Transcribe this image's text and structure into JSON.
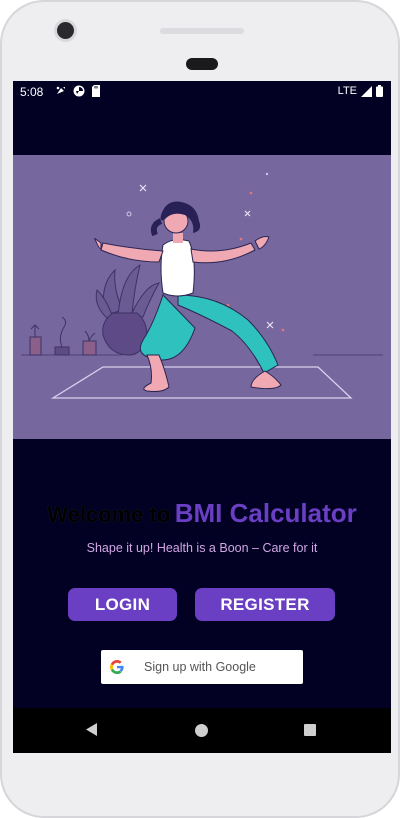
{
  "status_bar": {
    "time": "5:08",
    "network": "LTE",
    "icons_left": [
      "notification-icon",
      "pinwheel-icon",
      "sd-card-icon"
    ],
    "icons_right": [
      "signal-icon",
      "battery-icon"
    ]
  },
  "welcome": {
    "prefix": "Welcome to",
    "app_name": "BMI Calculator",
    "tagline": "Shape it up! Health is a Boon – Care for it"
  },
  "actions": {
    "login_label": "LOGIN",
    "register_label": "REGISTER",
    "google_label": "Sign up with Google"
  },
  "colors": {
    "screen_bg": "#020124",
    "hero_bg": "#76689f",
    "accent": "#6a3fc3",
    "tagline": "#d2a6e6"
  }
}
